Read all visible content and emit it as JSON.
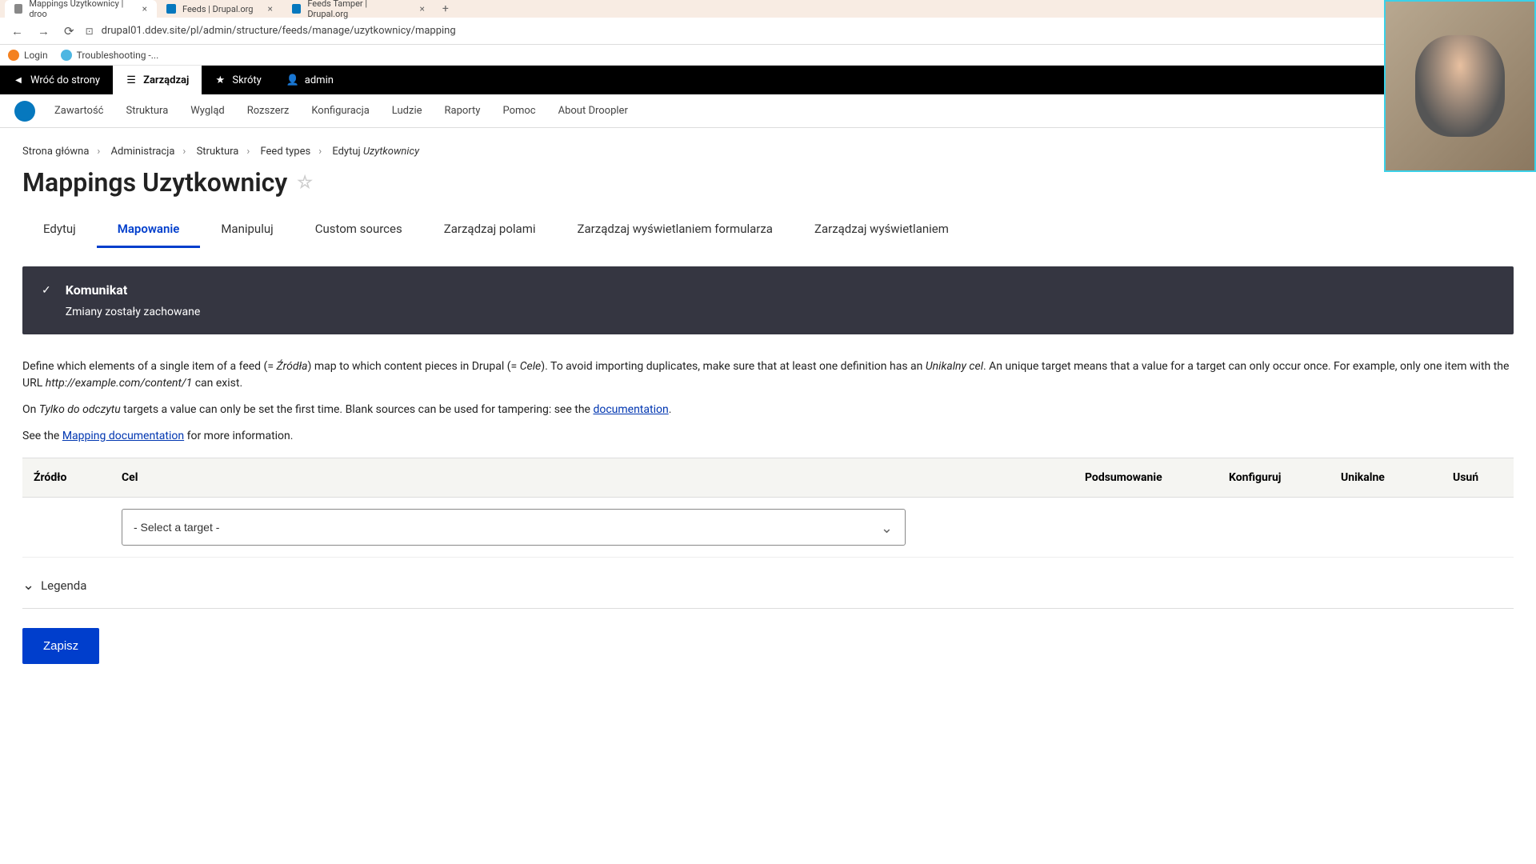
{
  "browser": {
    "tabs": [
      {
        "title": "Mappings Uzytkownicy | droo",
        "active": true
      },
      {
        "title": "Feeds | Drupal.org",
        "active": false
      },
      {
        "title": "Feeds Tamper | Drupal.org",
        "active": false
      }
    ],
    "url": "drupal01.ddev.site/pl/admin/structure/feeds/manage/uzytkownicy/mapping",
    "bookmarks": [
      "Login",
      "Troubleshooting -..."
    ]
  },
  "toolbar": {
    "back": "Wróć do strony",
    "manage": "Zarządzaj",
    "shortcuts": "Skróty",
    "user": "admin"
  },
  "admin_nav": {
    "items": [
      "Zawartość",
      "Struktura",
      "Wygląd",
      "Rozszerz",
      "Konfiguracja",
      "Ludzie",
      "Raporty",
      "Pomoc",
      "About Droopler"
    ]
  },
  "breadcrumb": {
    "items": [
      "Strona główna",
      "Administracja",
      "Struktura",
      "Feed types"
    ],
    "current_prefix": "Edytuj",
    "current_em": "Uzytkownicy"
  },
  "page_title": "Mappings Uzytkownicy",
  "tabs": {
    "items": [
      "Edytuj",
      "Mapowanie",
      "Manipuluj",
      "Custom sources",
      "Zarządzaj polami",
      "Zarządzaj wyświetlaniem formularza",
      "Zarządzaj wyświetlaniem"
    ],
    "active": "Mapowanie"
  },
  "message": {
    "title": "Komunikat",
    "text": "Zmiany zostały zachowane"
  },
  "help": {
    "p1_a": "Define which elements of a single item of a feed (= ",
    "p1_em1": "Źródła",
    "p1_b": ") map to which content pieces in Drupal (= ",
    "p1_em2": "Cele",
    "p1_c": "). To avoid importing duplicates, make sure that at least one definition has an ",
    "p1_em3": "Unikalny cel",
    "p1_d": ". An unique target means that a value for a target can only occur once. For example, only one item with the URL ",
    "p1_em4": "http://example.com/content/1",
    "p1_e": " can exist.",
    "p2_a": "On ",
    "p2_em": "Tylko do odczytu",
    "p2_b": " targets a value can only be set the first time. Blank sources can be used for tampering: see the ",
    "p2_link": "documentation",
    "p2_c": ".",
    "p3_a": "See the ",
    "p3_link": "Mapping documentation",
    "p3_b": " for more information."
  },
  "table": {
    "headers": {
      "source": "Źródło",
      "target": "Cel",
      "summary": "Podsumowanie",
      "configure": "Konfiguruj",
      "unique": "Unikalne",
      "delete": "Usuń"
    },
    "select_placeholder": "- Select a target -"
  },
  "legend_label": "Legenda",
  "save_label": "Zapisz"
}
